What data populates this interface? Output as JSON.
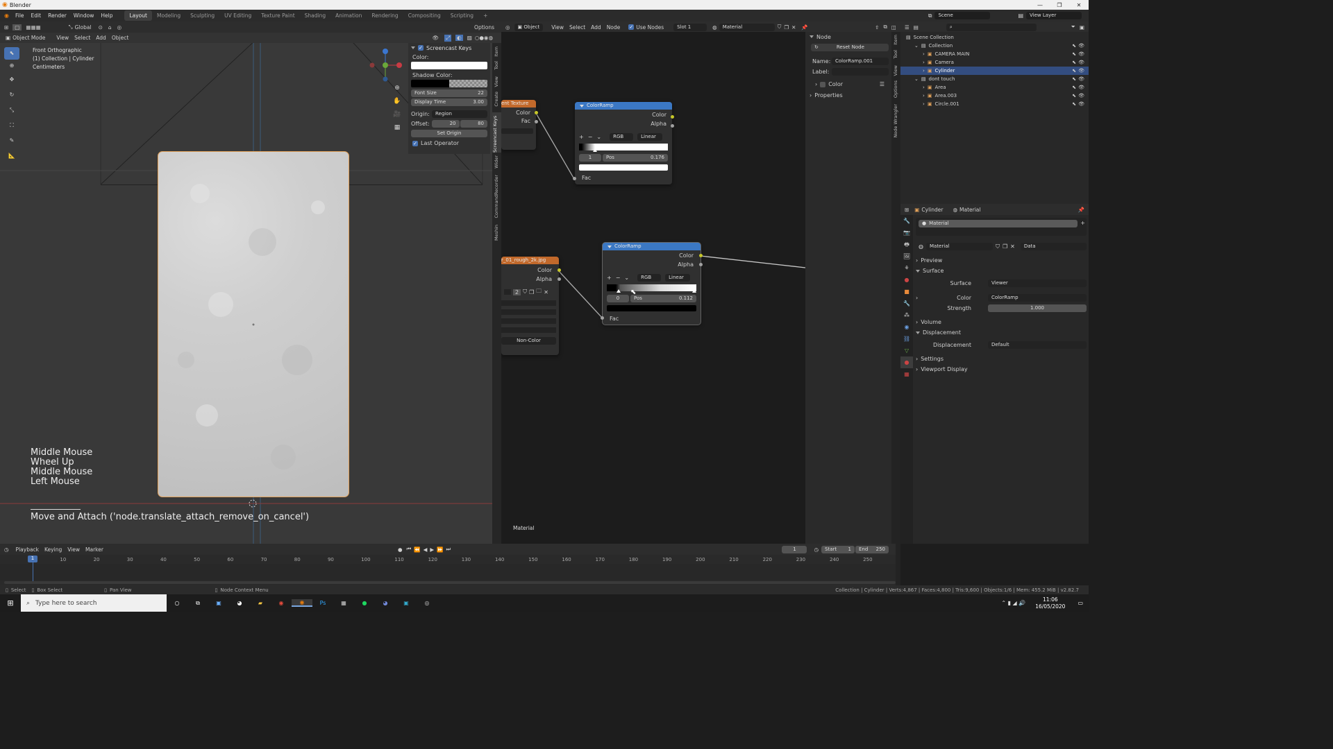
{
  "app": {
    "title": "Blender"
  },
  "menus": [
    "File",
    "Edit",
    "Render",
    "Window",
    "Help"
  ],
  "workspaces": [
    "Layout",
    "Modeling",
    "Sculpting",
    "UV Editing",
    "Texture Paint",
    "Shading",
    "Animation",
    "Rendering",
    "Compositing",
    "Scripting",
    "+"
  ],
  "scene": {
    "scene": "Scene",
    "view_layer": "View Layer"
  },
  "viewport": {
    "mode": "Object Mode",
    "menus": [
      "View",
      "Select",
      "Add",
      "Object"
    ],
    "orientation": "Global",
    "options": "Options",
    "overlay_lines": [
      "Front Orthographic",
      "(1) Collection | Cylinder",
      "Centimeters"
    ],
    "keys": [
      "Middle Mouse",
      "Wheel Up",
      "Middle Mouse",
      "Left Mouse"
    ],
    "operator": "Move and Attach ('node.translate_attach_remove_on_cancel')"
  },
  "screencast": {
    "title": "Screencast Keys",
    "color_label": "Color:",
    "shadow_label": "Shadow Color:",
    "font_size_label": "Font Size",
    "font_size": "22",
    "display_time_label": "Display Time",
    "display_time": "3.00",
    "origin_label": "Origin:",
    "origin": "Region",
    "offset_label": "Offset:",
    "offset_x": "20",
    "offset_y": "80",
    "set_origin": "Set Origin",
    "last_operator": "Last Operator"
  },
  "viewport_tabs": [
    "Item",
    "Tool",
    "View",
    "Create",
    "Screencast Keys",
    "Wider",
    "CommandRecorder",
    "Meshin"
  ],
  "node_editor": {
    "object_label": "Object",
    "menus": [
      "View",
      "Select",
      "Add",
      "Node"
    ],
    "use_nodes": "Use Nodes",
    "slot": "Slot 1",
    "material": "Material",
    "footer": "Material",
    "tex1_title": "ent Texture",
    "tex1_color": "Color",
    "tex1_fac": "Fac",
    "tex2_title": "r_01_rough_2k.jpg",
    "tex2_color": "Color",
    "tex2_alpha": "Alpha",
    "tex2_count": "2",
    "tex2_noncolor": "Non-Color",
    "ramp1": {
      "title": "ColorRamp",
      "out_color": "Color",
      "out_alpha": "Alpha",
      "mode": "RGB",
      "interp": "Linear",
      "index": "1",
      "pos_label": "Pos",
      "pos": "0.176",
      "fac": "Fac"
    },
    "ramp2": {
      "title": "ColorRamp",
      "out_color": "Color",
      "out_alpha": "Alpha",
      "mode": "RGB",
      "interp": "Linear",
      "index": "0",
      "pos_label": "Pos",
      "pos": "0.112",
      "fac": "Fac"
    }
  },
  "node_panel": {
    "section": "Node",
    "reset": "Reset Node",
    "name_label": "Name:",
    "name": "ColorRamp.001",
    "label_label": "Label:",
    "color": "Color",
    "properties": "Properties",
    "tabs": [
      "Item",
      "Tool",
      "View",
      "Options",
      "Node Wrangler"
    ]
  },
  "outliner": {
    "rows": [
      {
        "label": "Scene Collection",
        "indent": 0
      },
      {
        "label": "Collection",
        "indent": 1
      },
      {
        "label": "CAMERA MAIN",
        "indent": 2
      },
      {
        "label": "Camera",
        "indent": 2
      },
      {
        "label": "Cylinder",
        "indent": 2,
        "selected": true
      },
      {
        "label": "dont touch",
        "indent": 1
      },
      {
        "label": "Area",
        "indent": 2
      },
      {
        "label": "Area.003",
        "indent": 2
      },
      {
        "label": "Circle.001",
        "indent": 2
      }
    ]
  },
  "properties": {
    "object": "Cylinder",
    "material_tab": "Material",
    "slot": "Material",
    "material": "Material",
    "data": "Data",
    "sections": [
      "Preview",
      "Surface"
    ],
    "surface_label": "Surface",
    "surface": "Viewer",
    "color_label": "Color",
    "color": "ColorRamp",
    "strength_label": "Strength",
    "strength": "1.000",
    "volume": "Volume",
    "displacement": "Displacement",
    "displacement_label": "Displacement",
    "displacement_value": "Default",
    "settings": "Settings",
    "viewport_display": "Viewport Display"
  },
  "timeline": {
    "menus": [
      "Playback",
      "Keying",
      "View",
      "Marker"
    ],
    "current": "1",
    "start_label": "Start",
    "start": "1",
    "end_label": "End",
    "end": "250",
    "ticks": [
      "1",
      "10",
      "20",
      "30",
      "40",
      "50",
      "60",
      "70",
      "80",
      "90",
      "100",
      "110",
      "120",
      "130",
      "140",
      "150",
      "160",
      "170",
      "180",
      "190",
      "200",
      "210",
      "220",
      "230",
      "240",
      "250"
    ]
  },
  "statusbar": {
    "select": "Select",
    "box_select": "Box Select",
    "pan_view": "Pan View",
    "context_menu": "Node Context Menu",
    "stats": "Collection | Cylinder | Verts:4,867 | Faces:4,800 | Tris:9,600 | Objects:1/6 | Mem: 455.2 MiB | v2.82.7"
  },
  "taskbar": {
    "search_placeholder": "Type here to search",
    "time": "11:06",
    "date": "16/05/2020"
  },
  "colors": {
    "accent": "#4772b3",
    "ramp_header": "#3b78c4",
    "tex_header": "#c2692b",
    "socket": "#c7c729",
    "selection": "#e3a25a"
  }
}
